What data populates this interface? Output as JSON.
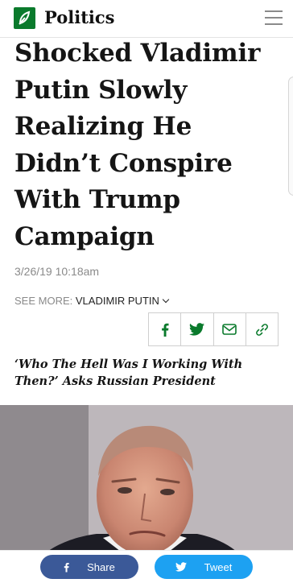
{
  "header": {
    "section": "Politics",
    "logo_icon": "onion-logo-icon",
    "menu_icon": "hamburger-menu-icon"
  },
  "article": {
    "headline": "Shocked Vladimir Putin Slowly Realizing He Didn’t Conspire With Trump Campaign",
    "date": "3/26/19 10:18am",
    "see_more_label": "SEE MORE:",
    "see_more_link": "VLADIMIR PUTIN",
    "subheadline": "‘Who The Hell Was I Working With Then?’ Asks Russian President"
  },
  "share_icons": [
    "facebook-icon",
    "twitter-icon",
    "email-icon",
    "link-icon"
  ],
  "bottom_bar": {
    "share_label": "Share",
    "tweet_label": "Tweet"
  },
  "colors": {
    "brand_green": "#0a7a2c",
    "facebook": "#3b5998",
    "twitter": "#1da1f2"
  }
}
